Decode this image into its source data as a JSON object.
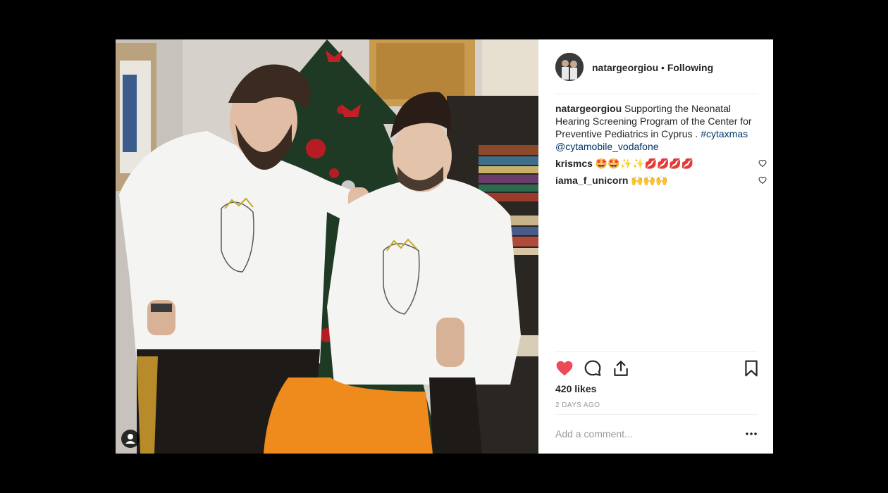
{
  "header": {
    "username": "natargeorgiou",
    "separator": " • ",
    "follow_status": "Following"
  },
  "caption": {
    "username": "natargeorgiou",
    "text": " Supporting the Neonatal Hearing Screening Program of the Center for Preventive Pediatrics in Cyprus . ",
    "hashtag": "#cytaxmas",
    "mention": "@cytamobile_vodafone"
  },
  "comments": [
    {
      "username": "krismcs",
      "text": "🤩🤩✨✨💋💋💋💋"
    },
    {
      "username": "iama_f_unicorn",
      "text": "🙌🙌🙌"
    }
  ],
  "actions": {
    "likes": "420 likes",
    "timestamp": "2 DAYS AGO",
    "comment_placeholder": "Add a comment..."
  },
  "icons": {
    "like": "heart-filled-icon",
    "comment": "comment-bubble-icon",
    "share": "share-icon",
    "save": "bookmark-icon",
    "comment_like": "heart-outline-icon",
    "more": "more-options-icon",
    "tagged": "user-tag-icon"
  },
  "colors": {
    "background": "#000000",
    "like_red": "#ed4956",
    "link": "#003569",
    "text": "#262626",
    "muted": "#999999"
  }
}
